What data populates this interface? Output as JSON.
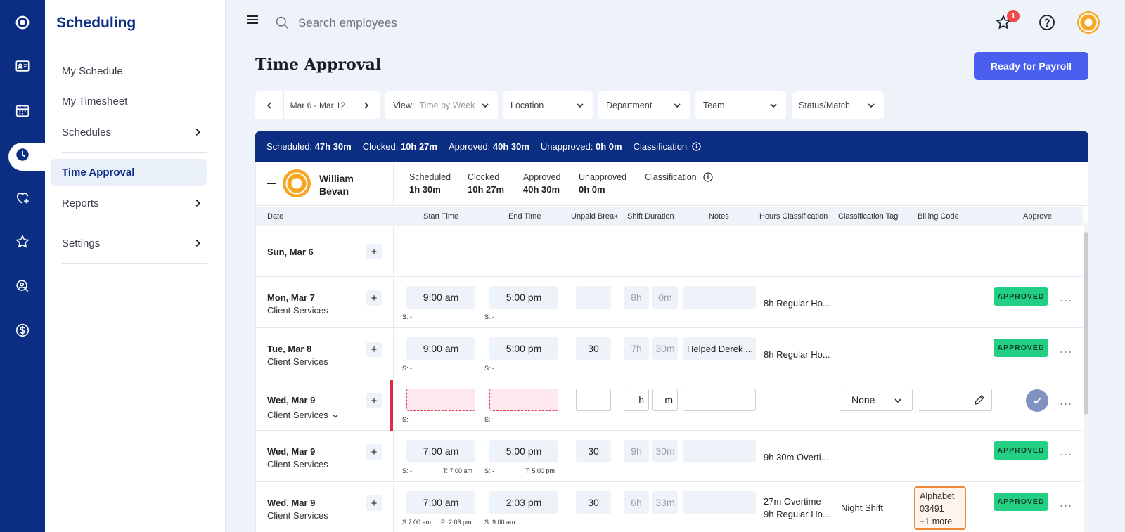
{
  "app": {
    "title": "Scheduling"
  },
  "rail": {
    "icons": [
      "logo-icon",
      "id-card-icon",
      "calendar-icon",
      "clock-icon",
      "heart-plus-icon",
      "star-icon",
      "search-person-icon",
      "dollar-icon"
    ]
  },
  "sidebar": {
    "items": [
      {
        "label": "My Schedule"
      },
      {
        "label": "My Timesheet"
      },
      {
        "label": "Schedules"
      },
      {
        "label": "Time Approval"
      },
      {
        "label": "Reports"
      },
      {
        "label": "Settings"
      }
    ]
  },
  "topbar": {
    "search_placeholder": "Search employees",
    "notification_count": "1"
  },
  "header": {
    "title": "Time Approval",
    "payroll_button": "Ready for Payroll"
  },
  "filters": {
    "date_range": "Mar 6 - Mar 12",
    "view_label": "View:",
    "view_value": "Time by Week",
    "location": "Location",
    "department": "Department",
    "team": "Team",
    "status": "Status/Match"
  },
  "summary": {
    "scheduled_label": "Scheduled:",
    "scheduled": "47h 30m",
    "clocked_label": "Clocked:",
    "clocked": "10h 27m",
    "approved_label": "Approved:",
    "approved": "40h 30m",
    "unapproved_label": "Unapproved:",
    "unapproved": "0h 0m",
    "classification_label": "Classification"
  },
  "employee": {
    "name": "William Bevan",
    "scheduled_label": "Scheduled",
    "scheduled": "1h 30m",
    "clocked_label": "Clocked",
    "clocked": "10h 27m",
    "approved_label": "Approved",
    "approved": "40h 30m",
    "unapproved_label": "Unapproved",
    "unapproved": "0h 0m",
    "classification_label": "Classification"
  },
  "columns": [
    "Date",
    "Start Time",
    "End Time",
    "Unpaid Break",
    "Shift Duration",
    "Notes",
    "Hours Classification",
    "Classification Tag",
    "Billing Code",
    "Approve"
  ],
  "rows": [
    {
      "date": "Sun, Mar 6"
    },
    {
      "date": "Mon, Mar 7",
      "dept": "Client Services",
      "start": "9:00 am",
      "end": "5:00 pm",
      "break": "",
      "dur_h": "8h",
      "dur_m": "0m",
      "notes": "",
      "s1": "S:  -",
      "s2": "S:  -",
      "hours": "8h Regular Ho...",
      "status": "APPROVED"
    },
    {
      "date": "Tue, Mar 8",
      "dept": "Client Services",
      "start": "9:00 am",
      "end": "5:00 pm",
      "break": "30",
      "dur_h": "7h",
      "dur_m": "30m",
      "notes": "Helped Derek ...",
      "s1": "S:  -",
      "s2": "S:  -",
      "hours": "8h Regular Ho...",
      "status": "APPROVED"
    },
    {
      "date": "Wed, Mar 9",
      "dept": "Client Services",
      "start": "",
      "end": "",
      "break": "",
      "dur_h": "h",
      "dur_m": "m",
      "notes": "",
      "s1": "S:  -",
      "s2": "S:  -",
      "tag": "None"
    },
    {
      "date": "Wed, Mar 9",
      "dept": "Client Services",
      "start": "7:00 am",
      "end": "5:00 pm",
      "break": "30",
      "dur_h": "9h",
      "dur_m": "30m",
      "notes": "",
      "s1": "S: -",
      "t1": "T:  7:00 am",
      "s2": "S: -",
      "t2": "T:  5:00 pm",
      "hours": "9h 30m Overti...",
      "status": "APPROVED"
    },
    {
      "date": "Wed, Mar 9",
      "dept": "Client Services",
      "start": "7:00 am",
      "end": "2:03 pm",
      "break": "30",
      "dur_h": "6h",
      "dur_m": "33m",
      "notes": "",
      "s1": "S:7:00 am",
      "p1": "P:  2:03 pm",
      "s2": "S:  9:00 am",
      "hours1": "27m Overtime",
      "hours2": "9h Regular Ho...",
      "tag": "Night Shift",
      "billing1": "Alphabet",
      "billing2": "03491",
      "billing3": "+1 more",
      "status": "APPROVED"
    }
  ]
}
